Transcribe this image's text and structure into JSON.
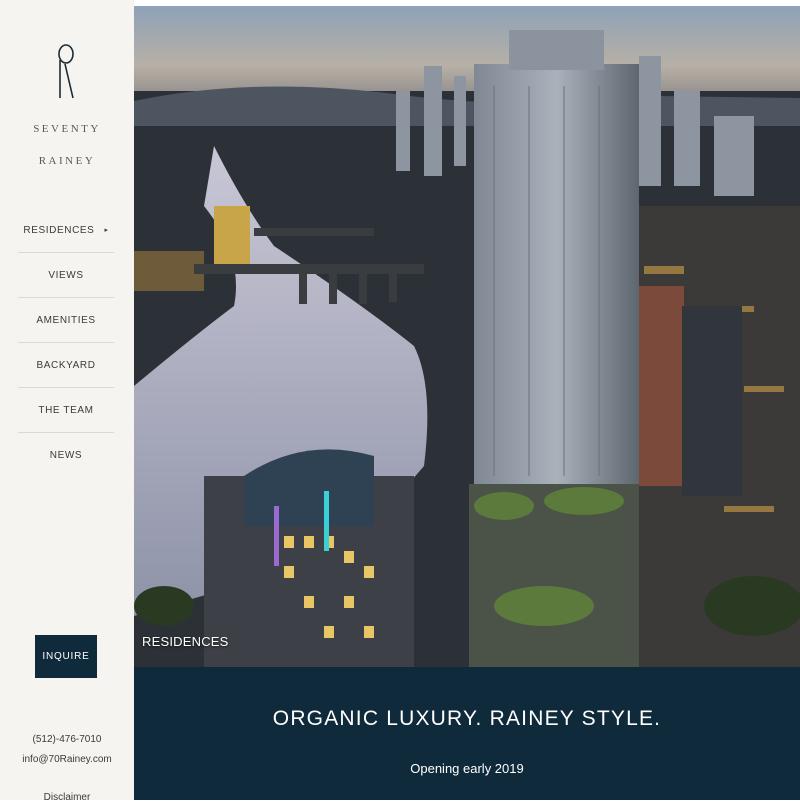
{
  "brand": {
    "logo_icon": "r-monogram-icon",
    "name_line1": "SEVENTY",
    "name_line2": "RAINEY"
  },
  "nav": {
    "items": [
      {
        "label": "RESIDENCES",
        "has_submenu": true
      },
      {
        "label": "VIEWS"
      },
      {
        "label": "AMENITIES"
      },
      {
        "label": "BACKYARD"
      },
      {
        "label": "THE TEAM"
      },
      {
        "label": "NEWS"
      }
    ],
    "submenu_indicator": "▸"
  },
  "inquire_label": "INQUIRE",
  "contact": {
    "phone": "(512)-476-7010",
    "email": "info@70Rainey.com",
    "disclaimer": "Disclaimer"
  },
  "hero": {
    "caption": "RESIDENCES"
  },
  "banner": {
    "tagline": "ORGANIC LUXURY. RAINEY STYLE.",
    "subline": "Opening early 2019"
  },
  "colors": {
    "sidebar_bg": "#f6f4f0",
    "navy": "#0f2a3a",
    "text": "#3a3a3a"
  }
}
